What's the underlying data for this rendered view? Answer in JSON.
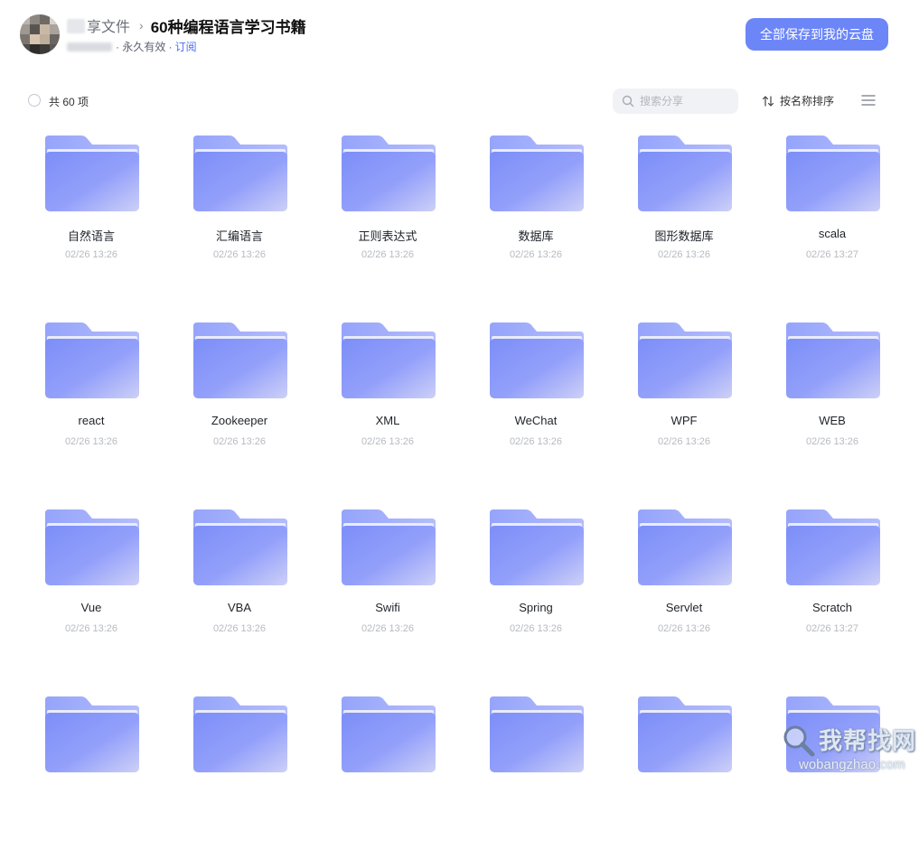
{
  "header": {
    "breadcrumb_root": "享文件",
    "breadcrumb_separator": "›",
    "title": "60种编程语言学习书籍",
    "validity": "· 永久有效 ·",
    "subscribe_label": "订阅",
    "save_button_label": "全部保存到我的云盘"
  },
  "toolbar": {
    "count_label": "共 60 项",
    "search_placeholder": "搜索分享",
    "sort_label": "按名称排序"
  },
  "files": [
    {
      "name": "自然语言",
      "date": "02/26 13:26"
    },
    {
      "name": "汇编语言",
      "date": "02/26 13:26"
    },
    {
      "name": "正则表达式",
      "date": "02/26 13:26"
    },
    {
      "name": "数据库",
      "date": "02/26 13:26"
    },
    {
      "name": "图形数据库",
      "date": "02/26 13:26"
    },
    {
      "name": "scala",
      "date": "02/26 13:27"
    },
    {
      "name": "react",
      "date": "02/26 13:26"
    },
    {
      "name": "Zookeeper",
      "date": "02/26 13:26"
    },
    {
      "name": "XML",
      "date": "02/26 13:26"
    },
    {
      "name": "WeChat",
      "date": "02/26 13:26"
    },
    {
      "name": "WPF",
      "date": "02/26 13:26"
    },
    {
      "name": "WEB",
      "date": "02/26 13:26"
    },
    {
      "name": "Vue",
      "date": "02/26 13:26"
    },
    {
      "name": "VBA",
      "date": "02/26 13:26"
    },
    {
      "name": "Swifi",
      "date": "02/26 13:26"
    },
    {
      "name": "Spring",
      "date": "02/26 13:26"
    },
    {
      "name": "Servlet",
      "date": "02/26 13:26"
    },
    {
      "name": "Scratch",
      "date": "02/26 13:27"
    },
    {
      "name": "",
      "date": ""
    },
    {
      "name": "",
      "date": ""
    },
    {
      "name": "",
      "date": ""
    },
    {
      "name": "",
      "date": ""
    },
    {
      "name": "",
      "date": ""
    },
    {
      "name": "",
      "date": ""
    }
  ],
  "watermark": {
    "text_cn": "我帮找网",
    "text_en": "wobangzhao.com"
  },
  "colors": {
    "accent": "#6c86f8",
    "link": "#4e6ef2",
    "folder_light": "#a3b0fb",
    "folder_main": "#7c8ef8"
  },
  "icons": [
    "avatar",
    "search-icon",
    "sort-icon",
    "list-view-icon",
    "folder-icon",
    "magnifier-watermark-icon"
  ]
}
